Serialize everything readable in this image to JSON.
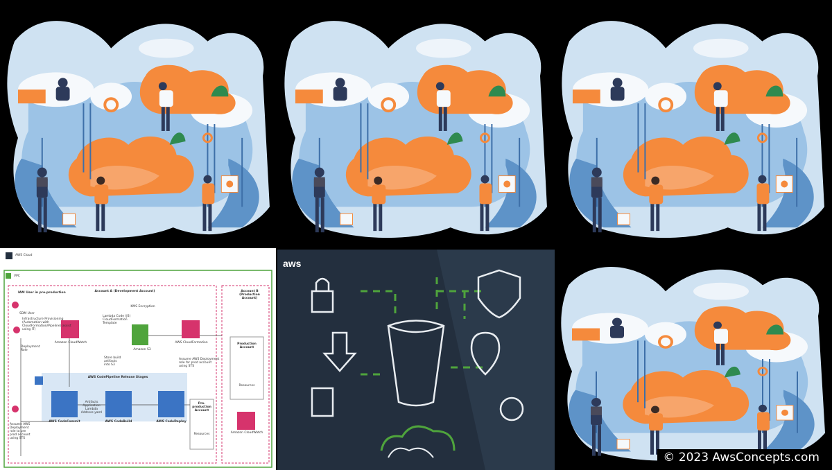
{
  "illustration": {
    "alt": "cloud-team-illustration"
  },
  "diagram": {
    "cloud_label": "AWS Cloud",
    "vpc_label": "VPC",
    "iam_user": "IAM User in pre-production",
    "dev_account": "Account A (Development Account)",
    "prod_account": "Account B\n(Production\nAccount)",
    "sdm_user": "SDM User",
    "step1": "Infrastructure Provisioning\n(Automation with\nCloudFormation/Pipeline) assist\nusing IT)",
    "deployment_role": "Deployment\nRole",
    "cloudwatch_a": "Amazon CloudWatch",
    "kms": "KMS Encryption",
    "lambda": "Lambda Code (JS)\nCloudFormation\nTemplate",
    "s3": "Amazon S3",
    "cfn": "AWS CloudFormation",
    "step2": "Store build\nartifacts\ninto S3",
    "step3": "Assume AWS Deployment\nrole for prod account\nusing STS",
    "prod_box": "Production\nAccount",
    "resources_a": "Resources",
    "pipeline": "AWS CodePipeline Release Stages",
    "commit": "AWS CodeCommit",
    "build": "AWS CodeBuild",
    "deploy": "AWS CodeDeploy",
    "artifacts": "Artifacts\nApplication Lambda\nAddress yaml",
    "preprod": "Pre-\nproduction\nAccount",
    "resources_b": "Resources",
    "step4": "Assume AWS\nDeployment\nrole to pre\nprod account\nusing STS",
    "cloudwatch_b": "Amazon CloudWatch"
  },
  "dark_panel": {
    "logo": "aws"
  },
  "watermark": {
    "text": "© 2023 AwsConcepts.com"
  },
  "colors": {
    "orange": "#f58a3c",
    "blue": "#6aa2d4",
    "dark_bg": "#232f3e",
    "green_line": "#4fa43c",
    "pink": "#d6336c"
  }
}
